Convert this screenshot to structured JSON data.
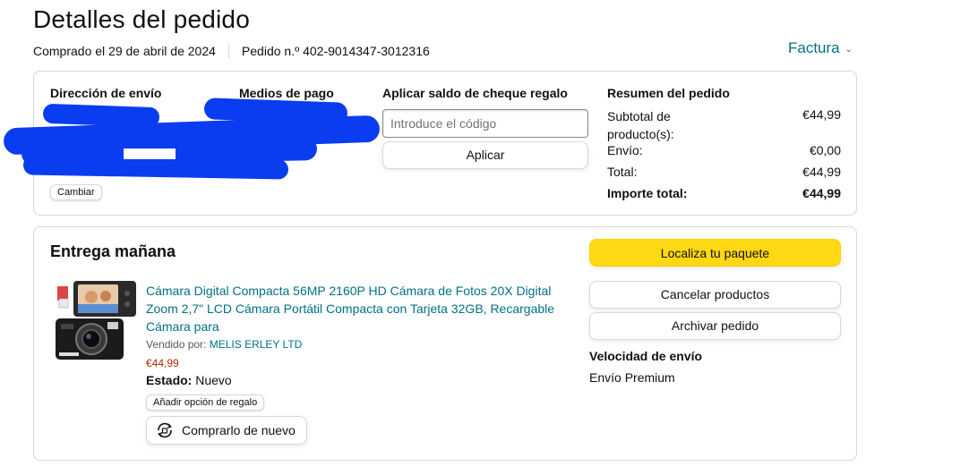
{
  "header": {
    "title": "Detalles del pedido",
    "purchased": "Comprado el 29 de abril de 2024",
    "order_number": "Pedido n.º 402-9014347-3012316",
    "invoice_label": "Factura"
  },
  "summary": {
    "shipping_address_heading": "Dirección de envío",
    "payment_heading": "Medios de pago",
    "change_label": "Cambiar",
    "gift_heading": "Aplicar saldo de cheque regalo",
    "gift_placeholder": "Introduce el código",
    "apply_label": "Aplicar",
    "order_summary_heading": "Resumen del pedido",
    "rows": [
      {
        "label": "Subtotal de producto(s):",
        "value": "€44,99"
      },
      {
        "label": "Envío:",
        "value": "€0,00"
      },
      {
        "label": "Total:",
        "value": "€44,99"
      },
      {
        "label": "Importe total:",
        "value": "€44,99"
      }
    ]
  },
  "delivery": {
    "title": "Entrega mañana",
    "product_title": "Cámara Digital Compacta 56MP 2160P HD Cámara de Fotos 20X Digital Zoom 2,7\" LCD Cámara Portátil Compacta con Tarjeta 32GB, Recargable Cámara para",
    "sold_by_label": "Vendido por:",
    "seller": "MELIS ERLEY LTD",
    "price": "€44,99",
    "condition_label": "Estado:",
    "condition_value": "Nuevo",
    "gift_option": "Añadir opción de regalo",
    "buy_again": "Comprarlo de nuevo",
    "actions": {
      "track": "Localiza tu paquete",
      "cancel": "Cancelar productos",
      "archive": "Archivar pedido"
    },
    "speed_heading": "Velocidad de envío",
    "speed_value": "Envío Premium"
  },
  "colors": {
    "link": "#007185",
    "price": "#b12704",
    "primary_button": "#ffd814",
    "redaction": "#0a3cf0"
  }
}
